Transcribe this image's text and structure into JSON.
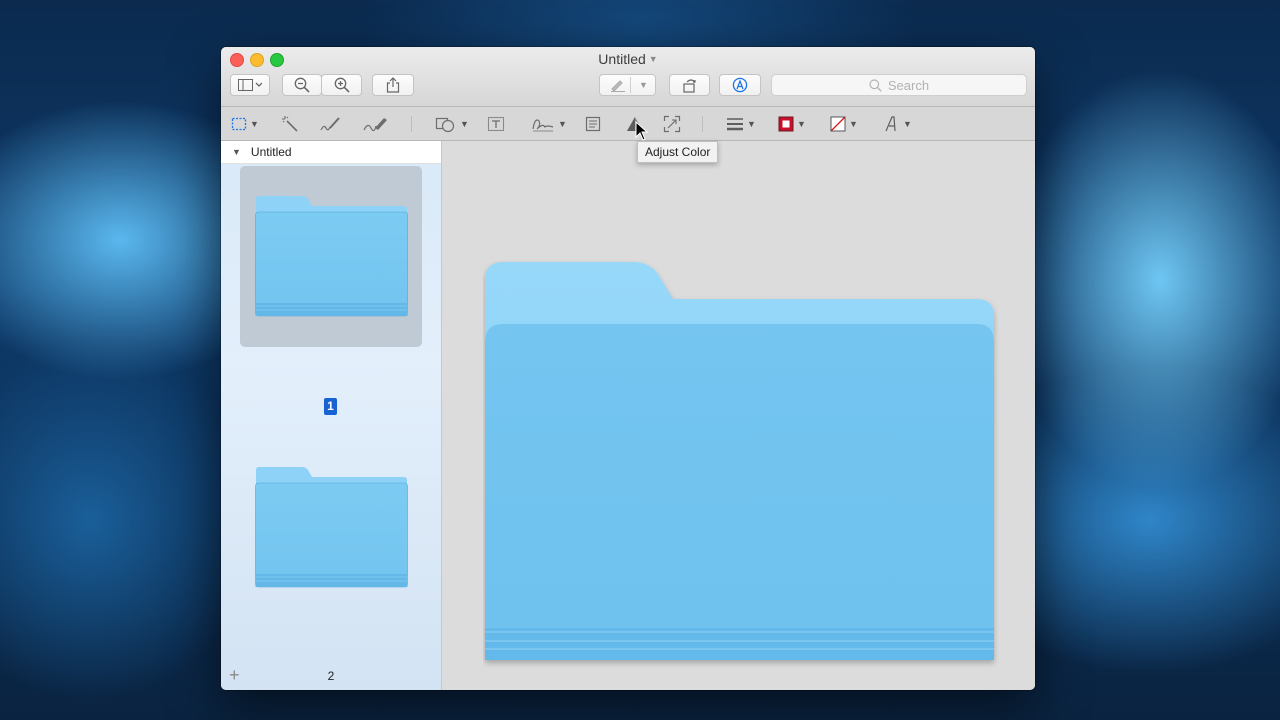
{
  "window": {
    "title": "Untitled",
    "title_chevron": "⌄"
  },
  "toolbar": {
    "search_placeholder": "Search",
    "icons": [
      "sidebar-view-icon",
      "zoom-out-icon",
      "zoom-in-icon",
      "share-icon",
      "highlight-icon",
      "rotate-icon",
      "markup-icon"
    ]
  },
  "markup_toolbar": {
    "tools": [
      "rect-selection",
      "instant-alpha",
      "sketch",
      "draw",
      "shapes",
      "text",
      "sign",
      "note",
      "adjust-color",
      "adjust-size",
      "shape-style",
      "border-color",
      "fill-color",
      "text-style"
    ],
    "border_color": "#c8102e",
    "fill_color": "#ffffff"
  },
  "tooltip": {
    "text": "Adjust Color"
  },
  "sidebar": {
    "document_title": "Untitled",
    "pages": [
      {
        "number": "1",
        "selected": true
      },
      {
        "number": "2",
        "selected": false
      }
    ],
    "add_label": "+"
  },
  "colors": {
    "folder_light": "#8ed3f7",
    "folder_dark": "#6ec3ef",
    "selection_blue": "#1763d3"
  }
}
